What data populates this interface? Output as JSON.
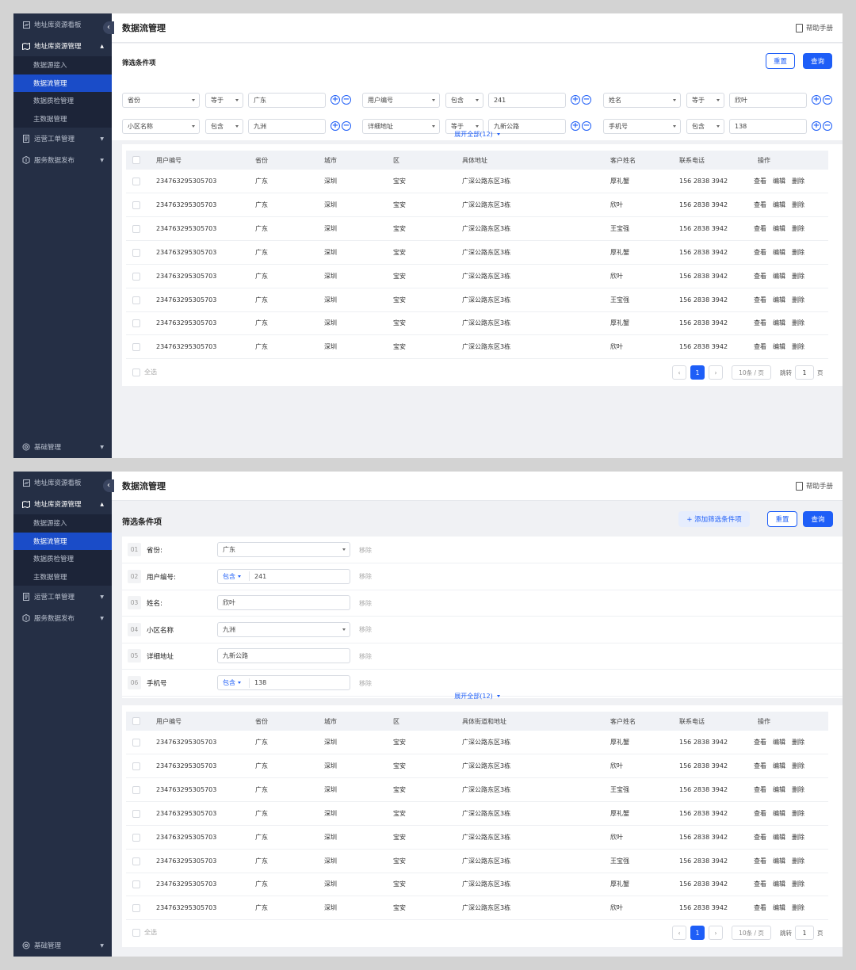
{
  "sidebar": {
    "collapse": "‹",
    "items": [
      {
        "label": "地址库资源看板",
        "icon": "dashboard-icon"
      },
      {
        "label": "地址库资源管理",
        "icon": "map-icon"
      },
      {
        "label": "运营工单管理",
        "icon": "ticket-icon"
      },
      {
        "label": "服务数据发布",
        "icon": "publish-icon"
      },
      {
        "label": "基础管理",
        "icon": "settings-icon"
      }
    ],
    "subitems": [
      "数据源接入",
      "数据流管理",
      "数据质检管理",
      "主数据管理"
    ]
  },
  "header": {
    "title": "数据流管理",
    "help": "帮助手册"
  },
  "filter": {
    "title": "筛选条件项",
    "reset": "重置",
    "query": "查询",
    "add": "+ 添加筛选条件项",
    "expand": "展开全部(12)",
    "row1": [
      {
        "field": "省份",
        "op": "等于",
        "value": "广东"
      },
      {
        "field": "用户编号",
        "op": "包含",
        "value": "241"
      },
      {
        "field": "姓名",
        "op": "等于",
        "value": "欣叶"
      }
    ],
    "row2": [
      {
        "field": "小区名称",
        "op": "包含",
        "value": "九洲"
      },
      {
        "field": "详细地址",
        "op": "等于",
        "value": "九新公路"
      },
      {
        "field": "手机号",
        "op": "包含",
        "value": "138"
      }
    ],
    "plus": "+",
    "minus": "−",
    "conditions": [
      {
        "num": "01",
        "label": "省份:",
        "value": "广东",
        "type": "select"
      },
      {
        "num": "02",
        "label": "用户编号:",
        "op": "包含",
        "value": "241",
        "type": "op"
      },
      {
        "num": "03",
        "label": "姓名:",
        "value": "欣叶",
        "type": "input"
      },
      {
        "num": "04",
        "label": "小区名称",
        "value": "九洲",
        "type": "select"
      },
      {
        "num": "05",
        "label": "详细地址",
        "value": "九新公路",
        "type": "input"
      },
      {
        "num": "06",
        "label": "手机号",
        "op": "包含",
        "value": "138",
        "type": "op"
      }
    ],
    "remove": "移除"
  },
  "table1": {
    "columns": [
      "用户编号",
      "省份",
      "城市",
      "区",
      "具体地址",
      "客户姓名",
      "联系电话",
      "操作"
    ]
  },
  "table2": {
    "columns": [
      "用户编号",
      "省份",
      "城市",
      "区",
      "具体街道和地址",
      "客户姓名",
      "联系电话",
      "操作"
    ]
  },
  "rows": [
    {
      "id": "234763295305703",
      "province": "广东",
      "city": "深圳",
      "district": "宝安",
      "address": "广深公路东区3栋",
      "name": "厚礼蟹",
      "phone": "156 2838 3942"
    },
    {
      "id": "234763295305703",
      "province": "广东",
      "city": "深圳",
      "district": "宝安",
      "address": "广深公路东区3栋",
      "name": "欣叶",
      "phone": "156 2838 3942"
    },
    {
      "id": "234763295305703",
      "province": "广东",
      "city": "深圳",
      "district": "宝安",
      "address": "广深公路东区3栋",
      "name": "王宝强",
      "phone": "156 2838 3942"
    },
    {
      "id": "234763295305703",
      "province": "广东",
      "city": "深圳",
      "district": "宝安",
      "address": "广深公路东区3栋",
      "name": "厚礼蟹",
      "phone": "156 2838 3942"
    },
    {
      "id": "234763295305703",
      "province": "广东",
      "city": "深圳",
      "district": "宝安",
      "address": "广深公路东区3栋",
      "name": "欣叶",
      "phone": "156 2838 3942"
    },
    {
      "id": "234763295305703",
      "province": "广东",
      "city": "深圳",
      "district": "宝安",
      "address": "广深公路东区3栋",
      "name": "王宝强",
      "phone": "156 2838 3942"
    },
    {
      "id": "234763295305703",
      "province": "广东",
      "city": "深圳",
      "district": "宝安",
      "address": "广深公路东区3栋",
      "name": "厚礼蟹",
      "phone": "156 2838 3942"
    },
    {
      "id": "234763295305703",
      "province": "广东",
      "city": "深圳",
      "district": "宝安",
      "address": "广深公路东区3栋",
      "name": "欣叶",
      "phone": "156 2838 3942"
    }
  ],
  "actions": {
    "view": "查看",
    "edit": "编辑",
    "delete": "删除"
  },
  "footer": {
    "select_all": "全选",
    "prev": "‹",
    "page": "1",
    "next": "›",
    "page_size": "10条 / 页",
    "jump": "跳转",
    "jump_value": "1",
    "page_unit": "页"
  },
  "colors": {
    "accent": "#1e5ef7",
    "sidebar": "#252f45",
    "sidebar_active": "#1a4cc8"
  }
}
